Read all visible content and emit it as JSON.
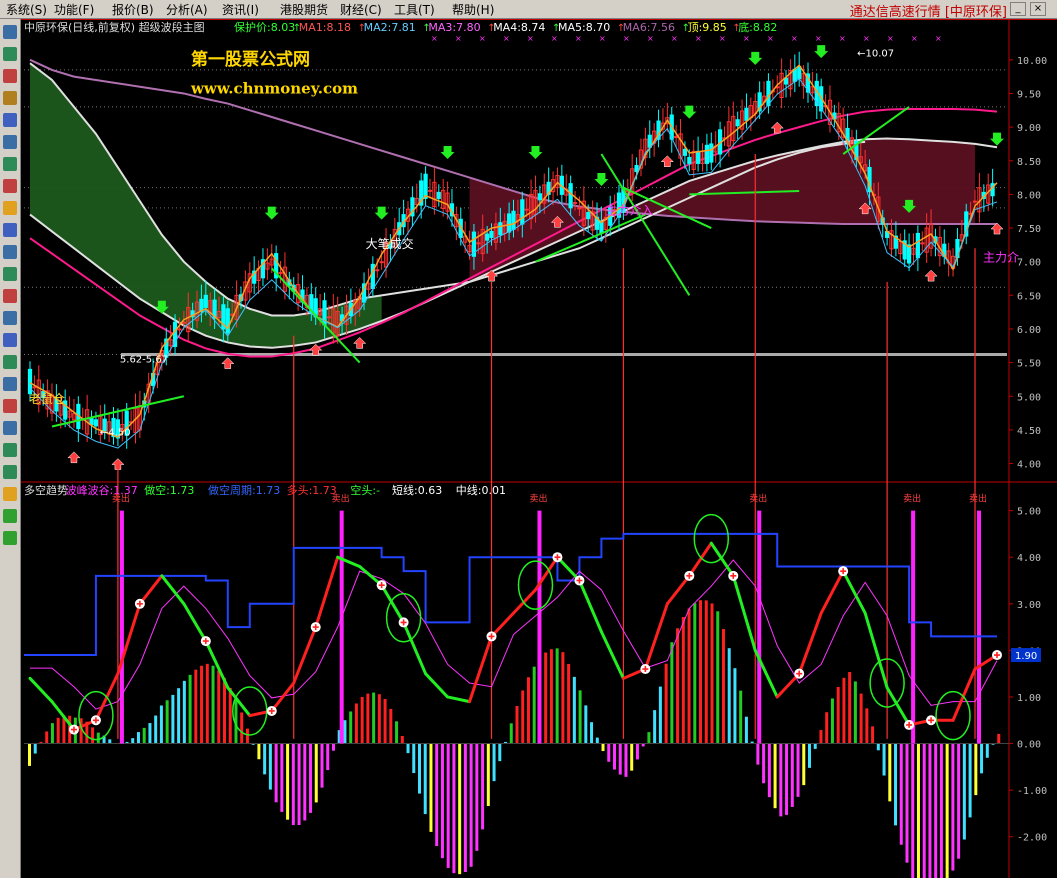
{
  "menu": {
    "items": [
      "系统(S)",
      "功能(F)",
      "报价(B)",
      "分析(A)",
      "资讯(I)",
      "港股期货",
      "财经(C)",
      "工具(T)",
      "帮助(H)"
    ],
    "app_title": "通达信高速行情 [中原环保]"
  },
  "header_top": [
    {
      "text": "中原环保(日线,前复权) 超级波段主图",
      "color": "#dddddd"
    },
    {
      "text": "保护价:8.03",
      "color": "#33ff33"
    },
    {
      "text": "MA1:8.18",
      "color": "#ff5555"
    },
    {
      "text": "MA2:7.81",
      "color": "#66ccff"
    },
    {
      "text": "MA3:7.80",
      "color": "#ff66ff"
    },
    {
      "text": "MA4:8.74",
      "color": "#ffffff"
    },
    {
      "text": "MA5:8.70",
      "color": "#ffffff"
    },
    {
      "text": "MA6:7.56",
      "color": "#aa66aa"
    },
    {
      "text": "顶:9.85",
      "color": "#ffff33"
    },
    {
      "text": "底:8.82",
      "color": "#33ff33"
    }
  ],
  "header_bottom": [
    {
      "text": "多空趋势",
      "color": "#dddddd"
    },
    {
      "text": "波峰波谷:1.37",
      "color": "#ff33ff"
    },
    {
      "text": "做空:1.73",
      "color": "#33ff33"
    },
    {
      "text": "做空周期:1.73",
      "color": "#3366ff"
    },
    {
      "text": "多头:1.73",
      "color": "#ff3333"
    },
    {
      "text": "空头:-",
      "color": "#33ff33"
    },
    {
      "text": "短线:0.63",
      "color": "#ffffff"
    },
    {
      "text": "中线:0.01",
      "color": "#ffffff"
    }
  ],
  "watermark": {
    "name": "第一股票公式网",
    "url": "www.chnmoney.com"
  },
  "annotations": {
    "big_volume": "大笔成交",
    "main_force": "主力介入",
    "main_force_2": "主力介",
    "old_position": "老鼠仓",
    "low_label": "4.50",
    "high_label": "10.07",
    "level_label": "5.62-5.67",
    "sell_mark": "卖出"
  },
  "current_value_badge": "1.90",
  "colors": {
    "up": "#ff3030",
    "down": "#00ffff",
    "ma_green": "#00ff00",
    "ma_magenta": "#ff33ff",
    "ma_white": "#e0e0e0",
    "axis_red": "#c00000",
    "band_green": "#1e5a1e",
    "band_red": "#5a1020"
  },
  "chart_data": [
    {
      "type": "line",
      "title": "中原环保(日线,前复权) 超级波段主图",
      "ylim": [
        3.8,
        10.25
      ],
      "yticks": [
        4.0,
        4.5,
        5.0,
        5.5,
        6.0,
        6.5,
        7.0,
        7.5,
        8.0,
        8.5,
        9.0,
        9.5,
        10.0
      ],
      "ytick_labels": [
        "4.00",
        "4.50",
        "5.00",
        "5.50",
        "6.00",
        "6.50",
        "7.00",
        "7.50",
        "8.00",
        "8.50",
        "9.00",
        "9.50",
        "10.00"
      ],
      "series": [
        {
          "name": "price",
          "values": [
            5.2,
            4.9,
            4.7,
            4.6,
            4.5,
            4.7,
            5.6,
            6.1,
            6.4,
            6.1,
            6.7,
            7.0,
            6.6,
            6.3,
            6.1,
            6.4,
            7.0,
            7.6,
            8.1,
            7.9,
            7.2,
            7.4,
            7.6,
            7.9,
            8.2,
            7.8,
            7.5,
            7.9,
            8.7,
            9.1,
            8.5,
            8.6,
            9.0,
            9.3,
            9.6,
            9.8,
            9.4,
            9.0,
            8.4,
            7.4,
            7.1,
            7.4,
            7.0,
            7.9,
            8.1
          ]
        },
        {
          "name": "MA4",
          "values": [
            9.95,
            9.7,
            9.3,
            8.9,
            8.4,
            7.9,
            7.4,
            7.0,
            6.7,
            6.45,
            6.3,
            6.2,
            6.2,
            6.25,
            6.35,
            6.45,
            6.5,
            6.55,
            6.6,
            6.65,
            6.7,
            6.8,
            6.9,
            7.0,
            7.1,
            7.2,
            7.35,
            7.5,
            7.65,
            7.8,
            7.95,
            8.1,
            8.25,
            8.4,
            8.52,
            8.62,
            8.7,
            8.75,
            8.78,
            8.8,
            8.8,
            8.78,
            8.75,
            8.72,
            8.74
          ]
        },
        {
          "name": "MA6",
          "values": [
            10.0,
            9.85,
            9.75,
            9.7,
            9.65,
            9.6,
            9.55,
            9.5,
            9.42,
            9.35,
            9.25,
            9.15,
            9.05,
            8.95,
            8.85,
            8.75,
            8.65,
            8.55,
            8.45,
            8.35,
            8.25,
            8.15,
            8.05,
            7.95,
            7.88,
            7.82,
            7.78,
            7.74,
            7.71,
            7.68,
            7.66,
            7.64,
            7.62,
            7.6,
            7.59,
            7.58,
            7.57,
            7.56,
            7.56,
            7.56,
            7.56,
            7.56,
            7.56,
            7.56,
            7.56
          ]
        },
        {
          "name": "MA5",
          "values": [
            7.7,
            7.45,
            7.2,
            6.95,
            6.7,
            6.45,
            6.25,
            6.05,
            5.9,
            5.8,
            5.74,
            5.72,
            5.75,
            5.8,
            5.9,
            6.0,
            6.12,
            6.25,
            6.4,
            6.55,
            6.7,
            6.85,
            7.0,
            7.15,
            7.3,
            7.45,
            7.6,
            7.75,
            7.9,
            8.05,
            8.2,
            8.3,
            8.4,
            8.5,
            8.58,
            8.65,
            8.72,
            8.78,
            8.82,
            8.83,
            8.82,
            8.8,
            8.78,
            8.75,
            8.7
          ]
        }
      ]
    },
    {
      "type": "bar",
      "title": "多空趋势",
      "ylim": [
        -2.8,
        5.55
      ],
      "yticks": [
        -2.0,
        -1.0,
        0.0,
        1.0,
        2.0,
        3.0,
        4.0,
        5.0
      ],
      "ytick_labels": [
        "-2.00",
        "-1.00",
        "0.00",
        "1.00",
        "2.00",
        "3.00",
        "4.00",
        "5.00"
      ],
      "series": [
        {
          "name": "短线",
          "values": [
            1.4,
            0.9,
            0.3,
            0.5,
            1.5,
            3.0,
            3.6,
            3.0,
            2.2,
            1.2,
            0.6,
            0.7,
            1.3,
            2.5,
            4.0,
            3.8,
            3.4,
            2.6,
            1.5,
            1.0,
            0.9,
            2.3,
            2.8,
            3.3,
            4.0,
            3.5,
            2.4,
            1.4,
            1.6,
            3.0,
            3.6,
            4.3,
            3.6,
            2.0,
            1.0,
            1.5,
            2.8,
            3.7,
            2.8,
            1.2,
            0.4,
            0.5,
            0.5,
            1.6,
            1.9
          ]
        },
        {
          "name": "做空周期",
          "values": [
            1.9,
            1.9,
            1.9,
            3.6,
            3.6,
            3.6,
            3.6,
            3.6,
            3.5,
            2.5,
            3.0,
            3.0,
            4.2,
            4.2,
            4.2,
            4.2,
            4.0,
            3.7,
            2.6,
            2.6,
            4.0,
            4.0,
            4.0,
            4.0,
            3.5,
            4.0,
            4.4,
            4.5,
            4.5,
            4.5,
            4.5,
            4.5,
            4.5,
            4.5,
            3.8,
            3.8,
            3.8,
            3.8,
            3.8,
            3.8,
            2.6,
            2.3,
            2.3,
            2.3,
            2.3
          ]
        }
      ]
    }
  ]
}
